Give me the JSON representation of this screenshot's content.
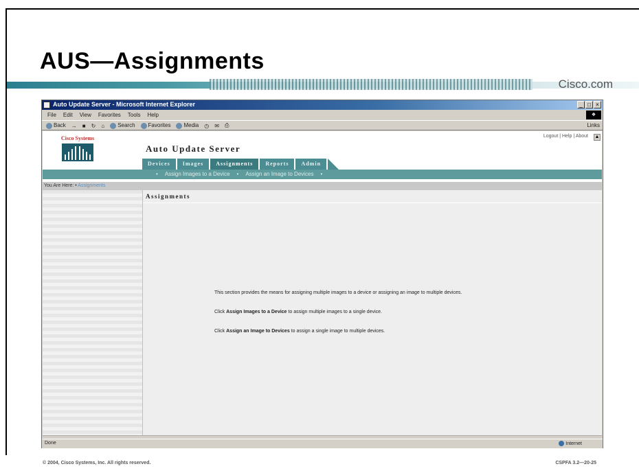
{
  "slide": {
    "title": "AUS—Assignments",
    "brand": "Cisco.com",
    "footer_copyright": "© 2004, Cisco Systems, Inc. All rights reserved.",
    "footer_code": "CSPFA 3.2—20-25"
  },
  "browser": {
    "window_title": "Auto Update Server - Microsoft Internet Explorer",
    "window_buttons": [
      "_",
      "□",
      "×"
    ],
    "menu": [
      "File",
      "Edit",
      "View",
      "Favorites",
      "Tools",
      "Help"
    ],
    "toolbar": [
      "Back",
      "→",
      "Search",
      "Favorites",
      "Media"
    ],
    "links_label": "Links",
    "status_text": "Done",
    "zone_text": "Internet"
  },
  "app": {
    "logo_text": "Cisco Systems",
    "title": "Auto Update Server",
    "util_links": "Logout | Help | About",
    "tabs": [
      {
        "label": "Devices",
        "active": false
      },
      {
        "label": "Images",
        "active": false
      },
      {
        "label": "Assignments",
        "active": true
      },
      {
        "label": "Reports",
        "active": false
      },
      {
        "label": "Admin",
        "active": false
      }
    ],
    "subnav": [
      "Assign Images to a Device",
      "Assign an Image to Devices"
    ],
    "breadcrumb_prefix": "You Are Here: •",
    "breadcrumb_current": "Assignments",
    "content_heading": "Assignments",
    "info_line1": "This section provides the means for assigning multiple images to a device or assigning an image to multiple devices.",
    "info_line2_prefix": "Click",
    "info_line2_bold": "Assign Images to a Device",
    "info_line2_suffix": "to assign multiple images to a single device.",
    "info_line3_prefix": "Click",
    "info_line3_bold": "Assign an Image to Devices",
    "info_line3_suffix": "to assign a single image to multiple devices."
  },
  "colors": {
    "tab_teal": "#4b8d92",
    "subnav_teal": "#5e9b9d",
    "title_blue": "#0a246a"
  }
}
